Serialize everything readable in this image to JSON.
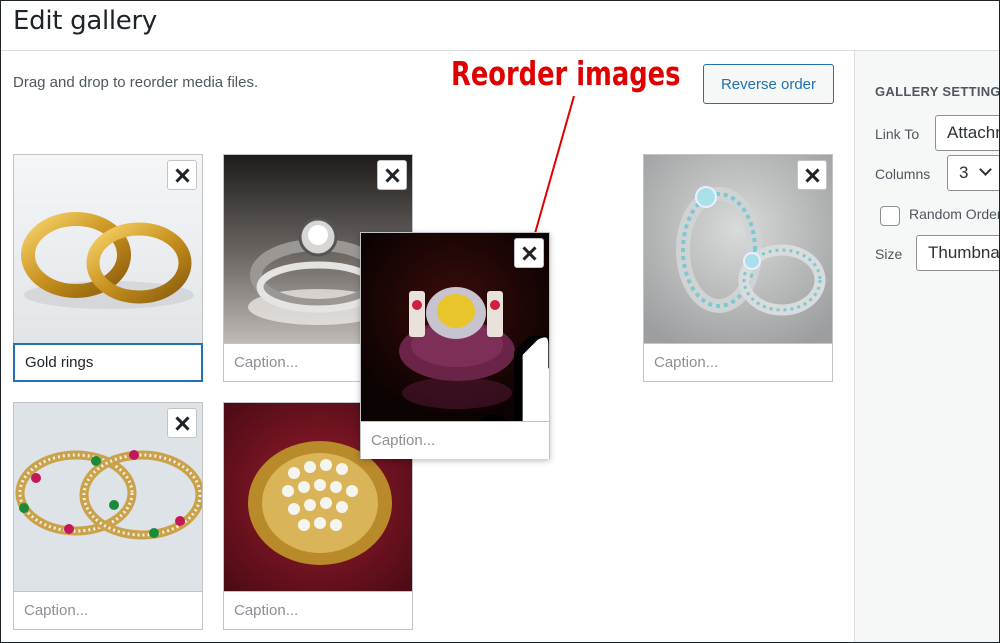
{
  "header": {
    "title": "Edit gallery"
  },
  "main": {
    "instructions": "Drag and drop to reorder media files.",
    "reverse_label": "Reverse order",
    "annotation": "Reorder images"
  },
  "sidebar": {
    "title": "GALLERY SETTINGS",
    "link_to": {
      "label": "Link To",
      "value": "Attachment Page"
    },
    "columns": {
      "label": "Columns",
      "value": "3"
    },
    "random_order": {
      "label": "Random Order",
      "checked": false
    },
    "size": {
      "label": "Size",
      "value": "Thumbnail"
    }
  },
  "tiles": [
    {
      "name": "gold-rings",
      "caption_value": "Gold rings",
      "caption_placeholder": "Caption..."
    },
    {
      "name": "silver-diamond-ring",
      "caption_value": "",
      "caption_placeholder": "Caption..."
    },
    {
      "name": "ruby-ring-dragging",
      "caption_value": "",
      "caption_placeholder": "Caption..."
    },
    {
      "name": "aquamarine-rings",
      "caption_value": "",
      "caption_placeholder": "Caption..."
    },
    {
      "name": "gem-bangles",
      "caption_value": "",
      "caption_placeholder": "Caption..."
    },
    {
      "name": "diamond-gold-ring",
      "caption_value": "",
      "caption_placeholder": "Caption..."
    }
  ],
  "colors": {
    "accent": "#2271b1",
    "annotation": "#e00000"
  }
}
